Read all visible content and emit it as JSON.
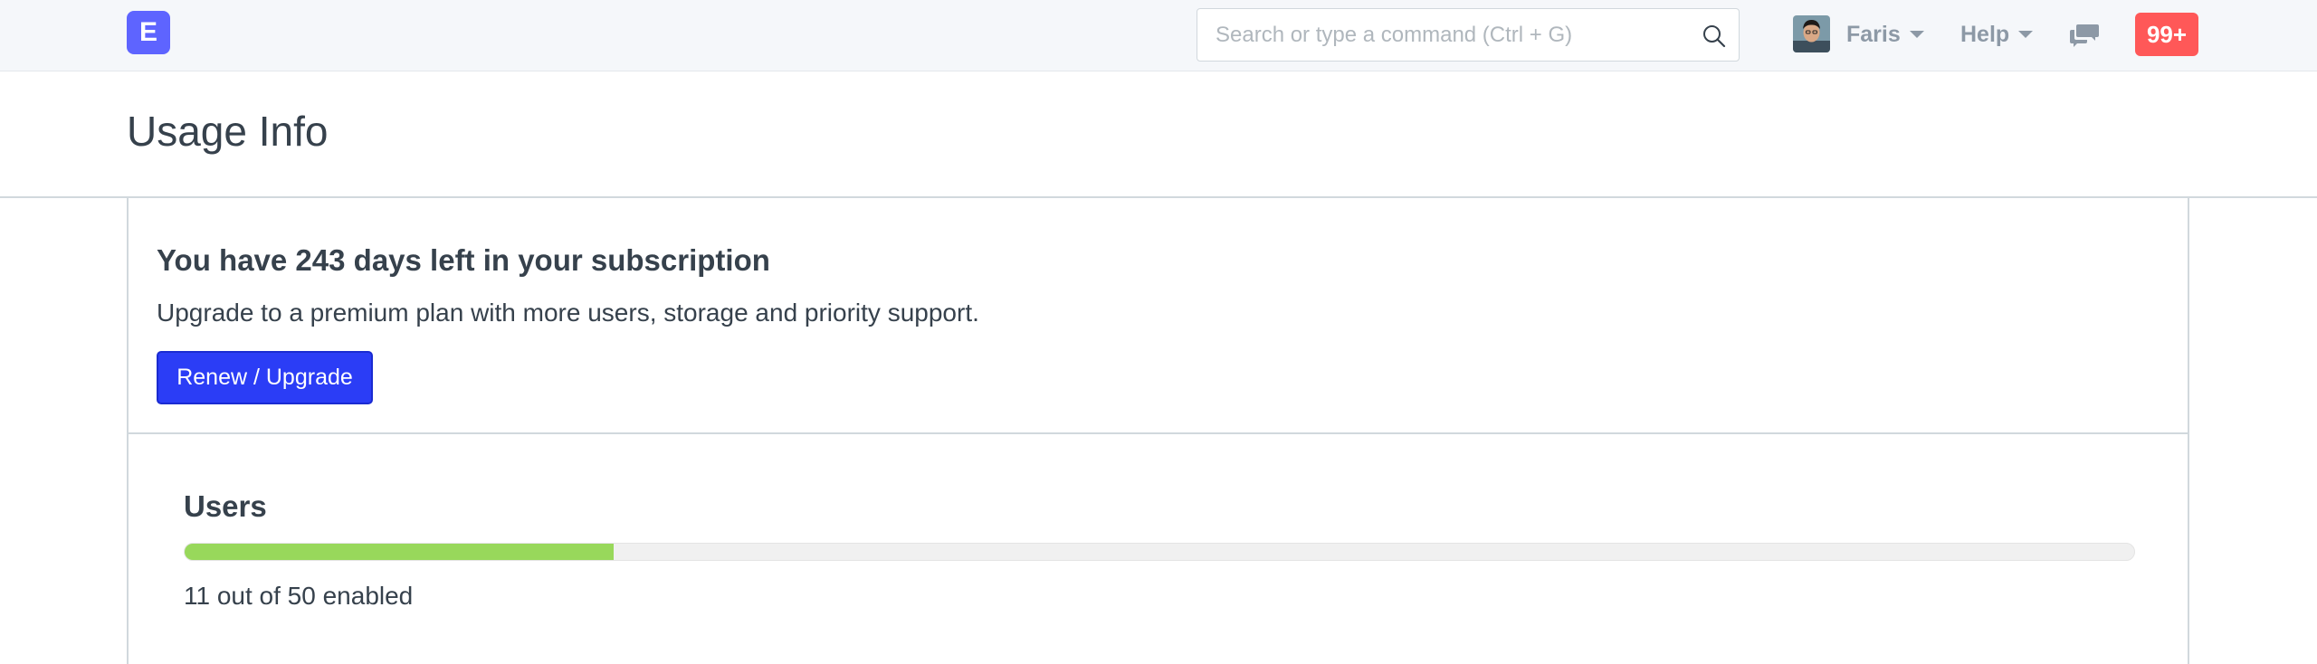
{
  "navbar": {
    "logo_letter": "E",
    "search_placeholder": "Search or type a command (Ctrl + G)",
    "user_name": "Faris",
    "help_label": "Help",
    "notification_count": "99+",
    "notification_color": "#ff5858",
    "logo_color": "#5e64ff"
  },
  "page": {
    "title": "Usage Info"
  },
  "subscription": {
    "heading": "You have 243 days left in your subscription",
    "description": "Upgrade to a premium plan with more users, storage and priority support.",
    "button_label": "Renew / Upgrade",
    "button_color": "#2b3df6"
  },
  "users": {
    "title": "Users",
    "enabled": 11,
    "limit": 50,
    "usage_text": "11 out of 50 enabled",
    "progress_fraction": 0.22,
    "progress_color": "#98d85b"
  }
}
